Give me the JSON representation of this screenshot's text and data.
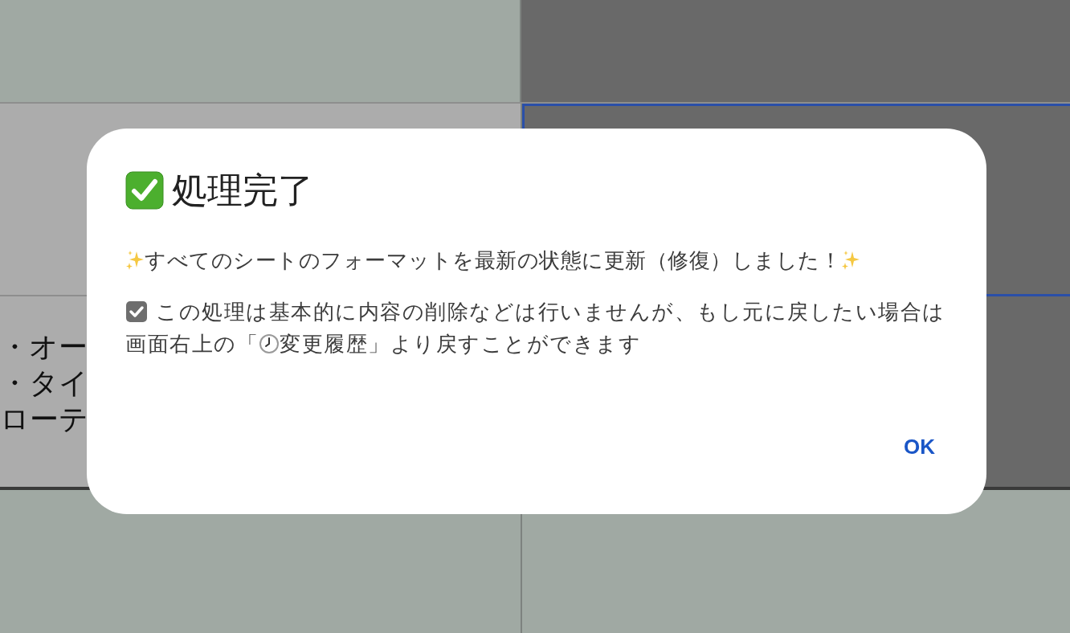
{
  "sheet": {
    "cell_lines": [
      "・オー",
      "・タイ",
      "ローテ"
    ]
  },
  "dialog": {
    "title": "処理完了",
    "message": "すべてのシートのフォーマットを最新の状態に更新（修復）しました！",
    "note": {
      "line_1": "この処理は基本的に内容の削除などは行いませんが、もし元に戻したい場合は",
      "line_2_before": "画面右上の「",
      "line_2_after": "変更履歴」より戻すことができます"
    },
    "buttons": [
      "OK"
    ]
  }
}
